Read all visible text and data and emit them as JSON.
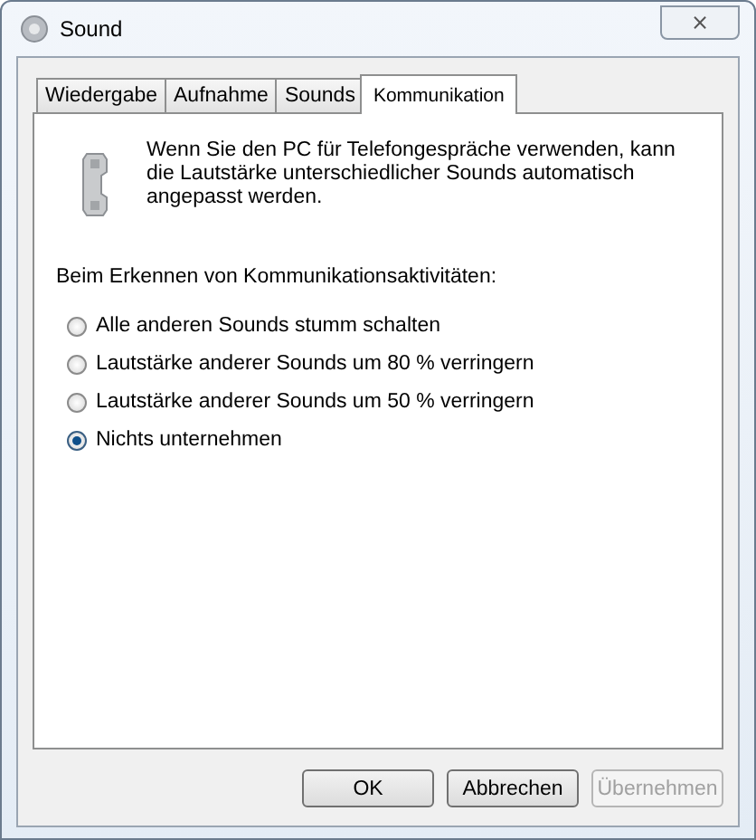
{
  "window": {
    "title": "Sound",
    "close": "⨯"
  },
  "tabs": [
    {
      "label": "Wiedergabe",
      "selected": false
    },
    {
      "label": "Aufnahme",
      "selected": false
    },
    {
      "label": "Sounds",
      "selected": false
    },
    {
      "label": "Kommunikation",
      "selected": true
    }
  ],
  "description": "Wenn Sie den PC für Telefongespräche verwenden, kann die Lautstärke unterschiedlicher Sounds automatisch angepasst werden.",
  "group_label": "Beim Erkennen von Kommunikationsaktivitäten:",
  "options": [
    {
      "label": "Alle anderen Sounds stumm schalten",
      "selected": false
    },
    {
      "label": "Lautstärke anderer Sounds um 80 % verringern",
      "selected": false
    },
    {
      "label": "Lautstärke anderer Sounds um 50 % verringern",
      "selected": false
    },
    {
      "label": "Nichts unternehmen",
      "selected": true
    }
  ],
  "buttons": [
    {
      "label": "OK",
      "disabled": false
    },
    {
      "label": "Abbrechen",
      "disabled": false
    },
    {
      "label": "Übernehmen",
      "disabled": true
    }
  ]
}
